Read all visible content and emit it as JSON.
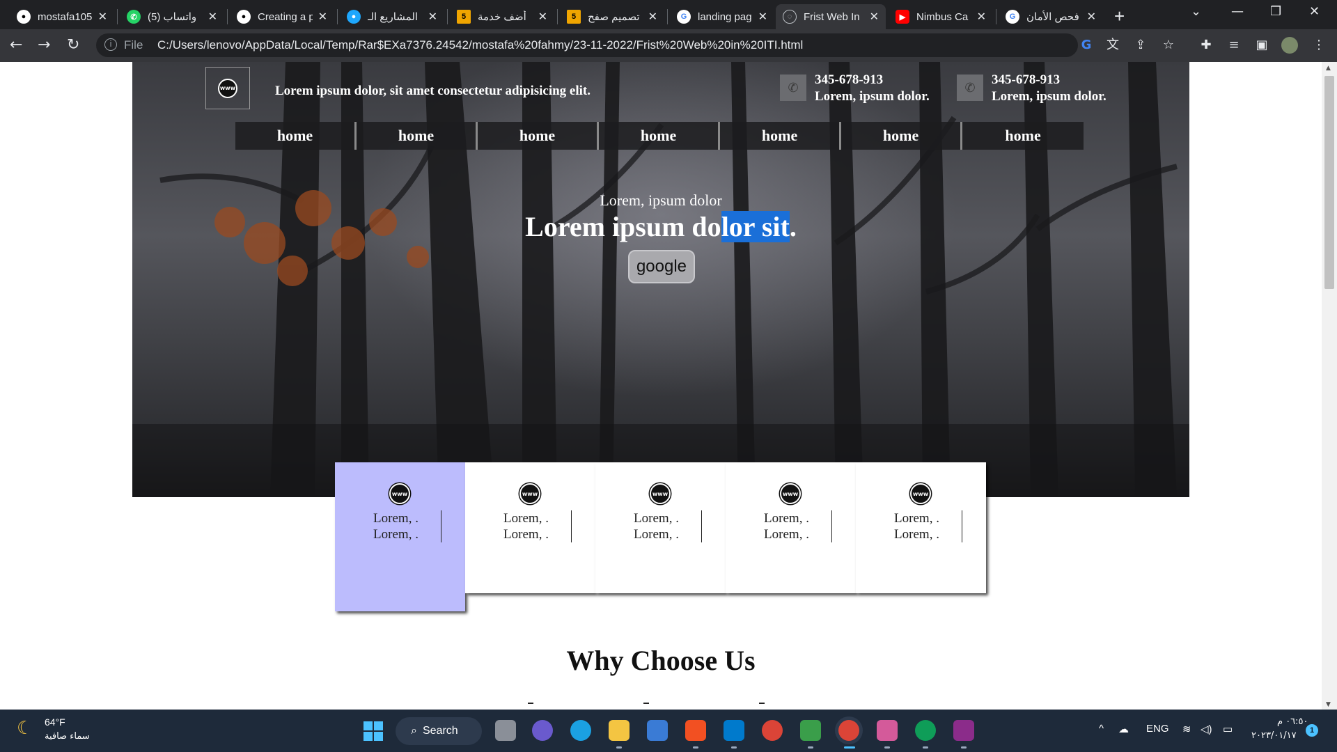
{
  "browser": {
    "tabs": [
      {
        "label": "mostafa105",
        "icon": "github-icon",
        "color": "#ffffff"
      },
      {
        "label": "(5) واتساب",
        "icon": "whatsapp-icon",
        "color": "#25d366"
      },
      {
        "label": "Creating a p",
        "icon": "github-icon",
        "color": "#ffffff"
      },
      {
        "label": "المشاريع الـ",
        "icon": "app-icon",
        "color": "#1ea7fd"
      },
      {
        "label": "أضف خدمة",
        "icon": "number-5-icon",
        "color": "#f0a500"
      },
      {
        "label": "تصميم صفح",
        "icon": "number-5-icon",
        "color": "#f0a500"
      },
      {
        "label": "landing pag",
        "icon": "google-icon",
        "color": "#ffffff"
      },
      {
        "label": "Frist Web In",
        "icon": "globe-icon",
        "color": "#bdc1c6"
      },
      {
        "label": "Nimbus Ca",
        "icon": "youtube-icon",
        "color": "#ff0000"
      },
      {
        "label": "فحص الأمان",
        "icon": "google-icon",
        "color": "#ffffff"
      }
    ],
    "fav_letters": {
      "number5": "5"
    },
    "url_scheme": "File",
    "url": "C:/Users/lenovo/AppData/Local/Temp/Rar$EXa7376.24542/mostafa%20fahmy/23-11-2022/Frist%20Web%20in%20ITI.html"
  },
  "page": {
    "tagline": "Lorem ipsum dolor, sit amet consectetur adipisicing elit.",
    "contacts": [
      {
        "phone": "345-678-913",
        "label": "Lorem, ipsum dolor."
      },
      {
        "phone": "345-678-913",
        "label": "Lorem, ipsum dolor."
      }
    ],
    "nav": [
      "home",
      "home",
      "home",
      "home",
      "home",
      "home",
      "home"
    ],
    "hero_subtitle": "Lorem, ipsum dolor",
    "hero_title_before": "Lorem ipsum do",
    "hero_title_selected": "lor sit",
    "hero_title_after": ".",
    "hero_button": "google",
    "globe_text": "www",
    "cards": [
      {
        "line1": "Lorem, .",
        "line2": "Lorem, .",
        "active": true
      },
      {
        "line1": "Lorem, .",
        "line2": "Lorem, .",
        "active": false
      },
      {
        "line1": "Lorem, .",
        "line2": "Lorem, .",
        "active": false
      },
      {
        "line1": "Lorem, .",
        "line2": "Lorem, .",
        "active": false
      },
      {
        "line1": "Lorem, .",
        "line2": "Lorem, .",
        "active": false
      }
    ],
    "section_title": "Why Choose Us",
    "colors": {
      "card_active": "#bcbcfd",
      "selection": "#1a6fd8"
    }
  },
  "taskbar": {
    "temperature": "64°F",
    "condition": "سماء صافية",
    "search_label": "Search",
    "language": "ENG",
    "time": "٠٦:٥٠ م",
    "date": "٢٠٢٣/٠١/١٧",
    "notifications": "1"
  }
}
